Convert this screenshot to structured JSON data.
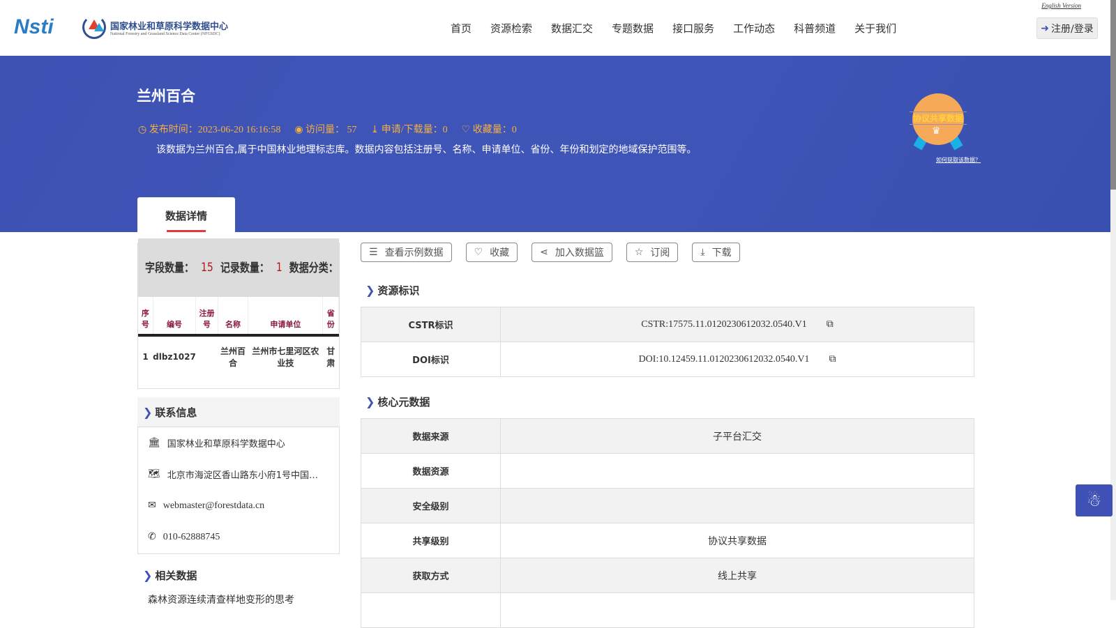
{
  "header": {
    "logo_nsti": "Nsti",
    "org_name_cn": "国家林业和草原科学数据中心",
    "org_name_en": "National Forestry and Grassland Science Data Center (NFGSDC)",
    "english_version": "English Version",
    "login": "注册/登录",
    "nav": [
      "首页",
      "资源检索",
      "数据汇交",
      "专题数据",
      "接口服务",
      "工作动态",
      "科普频道",
      "关于我们"
    ]
  },
  "banner": {
    "title": "兰州百合",
    "publish_time": "发布时间：2023-06-20 16:16:58",
    "visits": "访问量： 57",
    "downloads": "申请/下载量：0",
    "favorites": "收藏量：0",
    "description": "该数据为兰州百合,属于中国林业地理标志库。数据内容包括注册号、名称、申请单位、省份、年份和划定的地域保护范围等。",
    "badge": "协议共享数据",
    "how_to": "如何获取该数据？",
    "tab": "数据详情"
  },
  "preview": {
    "field_count_label": "字段数量：",
    "field_count": "15",
    "record_count_label": "记录数量：",
    "record_count": "1",
    "category_label": "数据分类：",
    "columns": [
      "序号",
      "编号",
      "注册号",
      "名称",
      "申请单位",
      "省份"
    ],
    "rows": [
      [
        "1",
        "dlbz1027",
        "",
        "兰州百合",
        "兰州市七里河区农业技",
        "甘肃"
      ]
    ]
  },
  "contact": {
    "title": "联系信息",
    "org": "国家林业和草原科学数据中心",
    "address": "北京市海淀区香山路东小府1号中国…",
    "email": "webmaster@forestdata.cn",
    "phone": "010-62888745"
  },
  "related": {
    "title": "相关数据",
    "first_item": "森林资源连续清查样地变形的思考"
  },
  "actions": [
    "查看示例数据",
    "收藏",
    "加入数据篮",
    "订阅",
    "下载"
  ],
  "identity": {
    "title": "资源标识",
    "rows": [
      {
        "k": "CSTR标识",
        "v": "CSTR:17575.11.0120230612032.0540.V1"
      },
      {
        "k": "DOI标识",
        "v": "DOI:10.12459.11.0120230612032.0540.V1"
      }
    ]
  },
  "core": {
    "title": "核心元数据",
    "rows": [
      {
        "k": "数据来源",
        "v": "子平台汇交"
      },
      {
        "k": "数据资源",
        "v": ""
      },
      {
        "k": "安全级别",
        "v": ""
      },
      {
        "k": "共享级别",
        "v": "协议共享数据"
      },
      {
        "k": "获取方式",
        "v": "线上共享"
      }
    ]
  }
}
